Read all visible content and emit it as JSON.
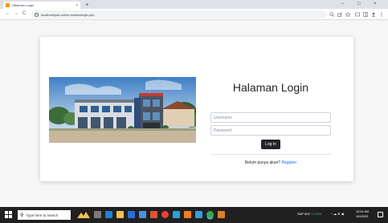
{
  "browser": {
    "tab_title": "Halaman Login",
    "tab_close": "×",
    "new_tab": "+",
    "window_controls": {
      "minimize": "–",
      "maximize": "□",
      "close": "×"
    },
    "nav": {
      "back": "←",
      "forward": "→",
      "reload": "C"
    },
    "url": "localhost/pab-online-master/login.php",
    "toolbar_icons": [
      "zoom-icon",
      "share-icon",
      "star-icon",
      "tab-search-icon",
      "sidebar-icon",
      "profile-icon",
      "menu-icon"
    ]
  },
  "login": {
    "title": "Halaman Login",
    "username_placeholder": "Username",
    "password_placeholder": "Password",
    "button_label": "Log In",
    "register_prompt": "Belum punya akun?",
    "register_link": "Register"
  },
  "taskbar": {
    "search_placeholder": "Type here to search",
    "apps": [
      "task-view",
      "edge",
      "file-explorer",
      "mail",
      "store",
      "office",
      "chrome",
      "photos",
      "xampp",
      "vscode",
      "chrome-active",
      "folder"
    ],
    "stock_label": "S&P 500",
    "stock_change": "+1.03%",
    "tray_icons": "^ ☁ ⊕ ◀",
    "clock_time": "10:24 AM",
    "clock_date": "6/4/2025"
  },
  "colors": {
    "link": "#0d6efd",
    "button": "#212529",
    "taskbar": "#202020",
    "favicon": "#f29900"
  }
}
